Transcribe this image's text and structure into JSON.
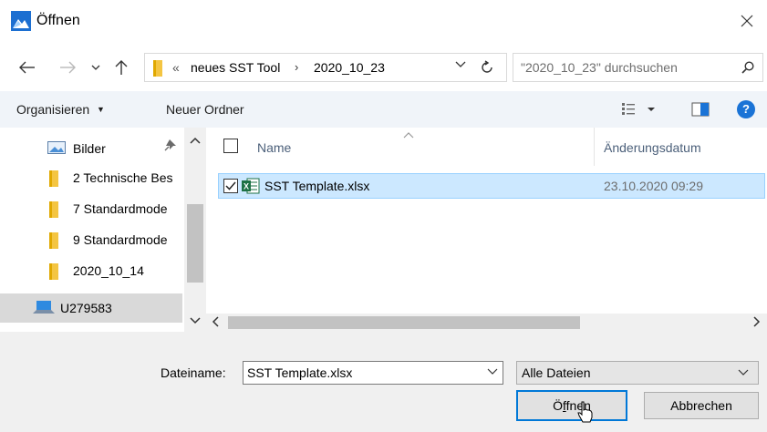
{
  "window": {
    "title": "Öffnen",
    "icon": "app-photo-icon"
  },
  "address": {
    "overflow": "«",
    "crumbs": [
      "neues SST Tool",
      "2020_10_23"
    ],
    "separator": "›"
  },
  "search": {
    "placeholder": "\"2020_10_23\" durchsuchen"
  },
  "toolbar": {
    "organize_label": "Organisieren",
    "new_folder_label": "Neuer Ordner",
    "help_label": "?"
  },
  "nav": {
    "items": [
      {
        "label": "Bilder",
        "icon": "pictures-icon"
      },
      {
        "label": "2 Technische Bes",
        "icon": "folder-icon"
      },
      {
        "label": "7 Standardmode",
        "icon": "folder-icon"
      },
      {
        "label": "9 Standardmode",
        "icon": "folder-icon"
      },
      {
        "label": "2020_10_14",
        "icon": "folder-icon"
      }
    ],
    "computer": {
      "label": "U279583",
      "icon": "computer-icon"
    }
  },
  "files": {
    "columns": [
      "Name",
      "Änderungsdatum"
    ],
    "rows": [
      {
        "name": "SST Template.xlsx",
        "date": "23.10.2020 09:29",
        "checked": true,
        "selected": true,
        "icon": "excel-icon"
      }
    ]
  },
  "footer": {
    "filename_label": "Dateiname:",
    "filename_value": "SST Template.xlsx",
    "filetype": "Alle Dateien",
    "open_prefix": "Ö",
    "open_mnemonic": "f",
    "open_suffix": "fnen",
    "cancel_label": "Abbrechen"
  },
  "colors": {
    "selection": "#cce8ff",
    "accent": "#0078d7",
    "toolbar_bg": "#f0f4f9",
    "footer_bg": "#f0f0f0"
  }
}
